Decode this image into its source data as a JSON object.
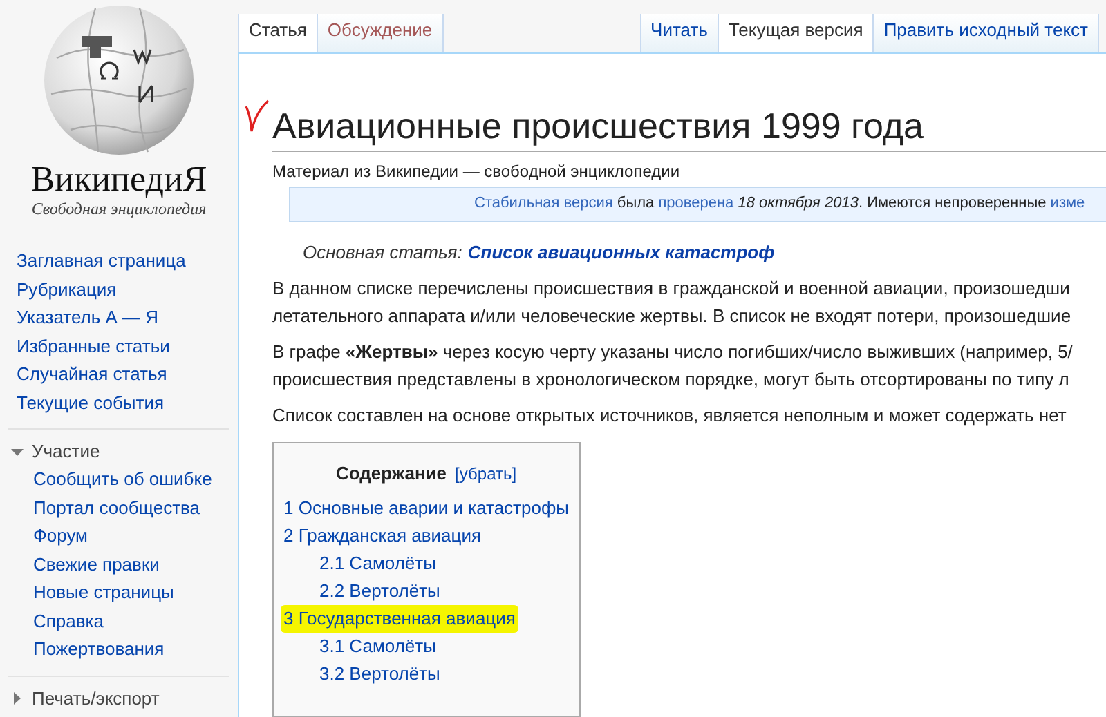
{
  "logo": {
    "wordmark": "ВикипедиЯ",
    "tagline": "Свободная энциклопедия"
  },
  "sidebar": {
    "items": [
      {
        "label": "Заглавная страница"
      },
      {
        "label": "Рубрикация"
      },
      {
        "label": "Указатель А — Я"
      },
      {
        "label": "Избранные статьи"
      },
      {
        "label": "Случайная статья"
      },
      {
        "label": "Текущие события"
      }
    ],
    "sections": [
      {
        "title": "Участие",
        "expanded": true,
        "items": [
          {
            "label": "Сообщить об ошибке"
          },
          {
            "label": "Портал сообщества"
          },
          {
            "label": "Форум"
          },
          {
            "label": "Свежие правки"
          },
          {
            "label": "Новые страницы"
          },
          {
            "label": "Справка"
          },
          {
            "label": "Пожертвования"
          }
        ]
      },
      {
        "title": "Печать/экспорт",
        "expanded": false
      }
    ]
  },
  "namespace_tabs": [
    {
      "label": "Статья",
      "selected": true,
      "kind": "existing"
    },
    {
      "label": "Обсуждение",
      "selected": false,
      "kind": "missing"
    }
  ],
  "view_tabs": [
    {
      "label": "Читать",
      "selected": false
    },
    {
      "label": "Текущая версия",
      "selected": true
    },
    {
      "label": "Править исходный текст",
      "selected": false
    }
  ],
  "article": {
    "title": "Авиационные происшествия 1999 года",
    "tagline": "Материал из Википедии — свободной энциклопедии",
    "notice": [
      {
        "kind": "link",
        "text": "Стабильная версия"
      },
      {
        "kind": "text",
        "text": " была "
      },
      {
        "kind": "link",
        "text": "проверена"
      },
      {
        "kind": "italic",
        "text": " 18 октября 2013"
      },
      {
        "kind": "text",
        "text": ". Имеются непроверенные "
      },
      {
        "kind": "link",
        "text": "изме"
      }
    ],
    "hatnote": {
      "label": "Основная статья:",
      "link": "Список авиационных катастроф"
    },
    "paragraphs": [
      [
        "В данном списке перечислены происшествия в гражданской и военной авиации, произошедши",
        "летательного аппарата и/или человеческие жертвы. В список не входят потери, произошедшие"
      ],
      [
        "В графе **«Жертвы»** через косую черту указаны число погибших/число выживших (например, 5/",
        "происшествия представлены в хронологическом порядке, могут быть отсортированы по типу л"
      ],
      [
        "Список составлен на основе открытых источников, является неполным и может содержать нет"
      ]
    ],
    "toc": {
      "title": "Содержание",
      "toggle": "[убрать]",
      "items": [
        {
          "label": "1 Основные аварии и катастрофы",
          "highlighted": false
        },
        {
          "label": "2 Гражданская авиация",
          "highlighted": false,
          "children": [
            {
              "label": "2.1 Самолёты",
              "highlighted": false
            },
            {
              "label": "2.2 Вертолёты",
              "highlighted": false
            }
          ]
        },
        {
          "label": "3 Государственная авиация",
          "highlighted": true,
          "children": [
            {
              "label": "3.1 Самолёты",
              "highlighted": false
            },
            {
              "label": "3.2 Вертолёты",
              "highlighted": false
            }
          ]
        }
      ]
    }
  }
}
